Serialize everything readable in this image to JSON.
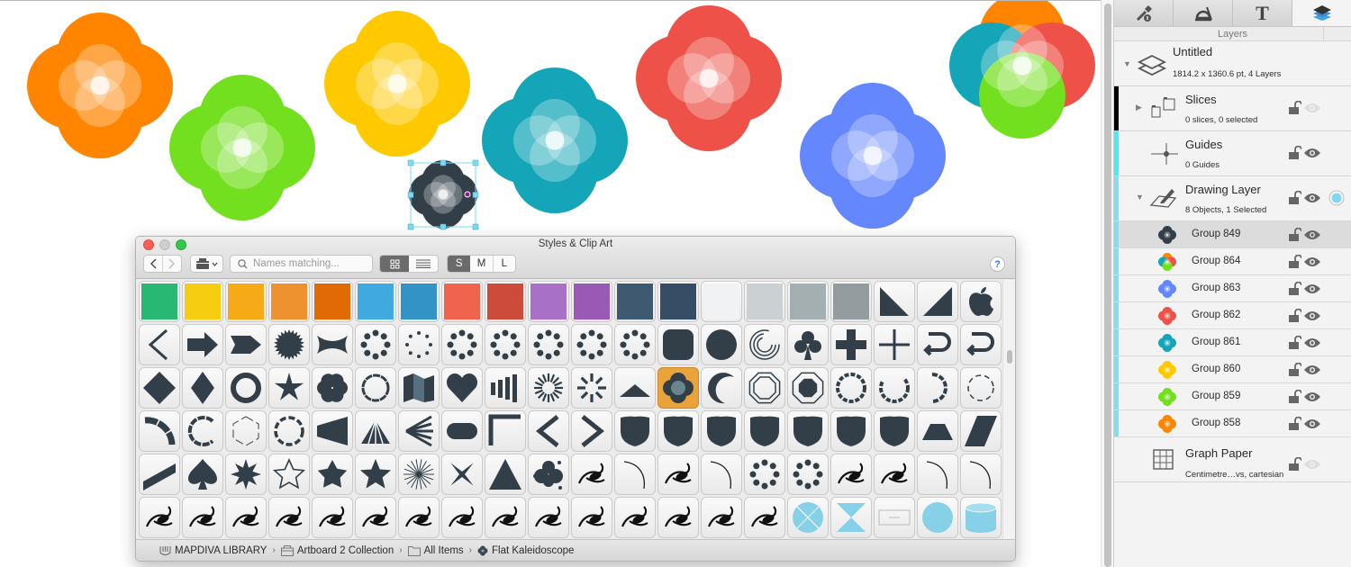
{
  "canvas": {
    "flowers": [
      {
        "name": "orange-flower",
        "color": "#ff8400"
      },
      {
        "name": "green-flower",
        "color": "#72e01e"
      },
      {
        "name": "yellow-flower",
        "color": "#ffc900"
      },
      {
        "name": "teal-flower",
        "color": "#14a6b8"
      },
      {
        "name": "red-flower",
        "color": "#ee5147"
      },
      {
        "name": "blue-flower",
        "color": "#6487fe"
      },
      {
        "name": "mixed-flower",
        "colors": [
          "#14a6b8",
          "#ee5147",
          "#ff8400",
          "#72e01e"
        ]
      },
      {
        "name": "dark-flower-selected",
        "color": "#333f48",
        "selected": true
      }
    ],
    "selection_color": "#7fd9f0"
  },
  "inspector": {
    "tabs": [
      {
        "name": "style-tab",
        "icon": "paint-dropper-icon"
      },
      {
        "name": "geometry-tab",
        "icon": "protractor-icon"
      },
      {
        "name": "text-tab",
        "icon": "text-T-icon",
        "label": "T"
      },
      {
        "name": "layers-tab",
        "icon": "layers-icon",
        "active": true
      }
    ],
    "section_label": "Layers",
    "document": {
      "title": "Untitled",
      "subtitle": "1814.2 x 1360.6 pt, 4 Layers"
    },
    "layers": [
      {
        "title": "Slices",
        "subtitle": "0 slices, 0 selected",
        "stripe": "#000000",
        "visible": false,
        "collapsed": true
      },
      {
        "title": "Guides",
        "subtitle": "0 Guides",
        "stripe": "#3ff0f5",
        "visible": true
      },
      {
        "title": "Drawing Layer",
        "subtitle": "8 Objects, 1 Selected",
        "stripe": "#7de0f3",
        "visible": true,
        "expanded": true,
        "active_color": "#7ed7f7"
      },
      {
        "title": "Graph Paper",
        "subtitle": "Centimetre…vs, cartesian",
        "visible": false
      }
    ],
    "objects": [
      {
        "label": "Group 849",
        "selected": true,
        "colors": [
          "#333f48"
        ]
      },
      {
        "label": "Group 864",
        "colors": [
          "#14a6b8",
          "#ee5147",
          "#ff8400",
          "#72e01e"
        ]
      },
      {
        "label": "Group 863",
        "colors": [
          "#6487fe"
        ]
      },
      {
        "label": "Group 862",
        "colors": [
          "#ee5147"
        ]
      },
      {
        "label": "Group 861",
        "colors": [
          "#14a6b8"
        ]
      },
      {
        "label": "Group 860",
        "colors": [
          "#ffc900"
        ]
      },
      {
        "label": "Group 859",
        "colors": [
          "#72e01e"
        ]
      },
      {
        "label": "Group 858",
        "colors": [
          "#ff8400"
        ]
      }
    ]
  },
  "styles_window": {
    "title": "Styles & Clip Art",
    "search_placeholder": "Names matching...",
    "view_modes": [
      "grid",
      "list"
    ],
    "active_view": "grid",
    "sizes": [
      "S",
      "M",
      "L"
    ],
    "active_size": "S",
    "help": "?",
    "swatches": [
      "#28b873",
      "#f6cd10",
      "#f7aa18",
      "#ee9230",
      "#e06a04",
      "#3fa9e0",
      "#3293c6",
      "#f0644e",
      "#cd4b3a",
      "#a970c7",
      "#9b59b6",
      "#3f5a70",
      "#354d65",
      "#f1f2f3",
      "#cbd1d3",
      "#a4afb1",
      "#939c9e"
    ],
    "items": [
      "swatch",
      "swatch",
      "swatch",
      "swatch",
      "swatch",
      "swatch",
      "swatch",
      "swatch",
      "swatch",
      "swatch",
      "swatch",
      "swatch",
      "swatch",
      "swatch",
      "swatch",
      "swatch",
      "swatch",
      "triangle-right-angle",
      "triangle-right-angle-mirrored",
      "apple-logo",
      "chevron-left",
      "arrow-right",
      "arrow-notched",
      "starburst",
      "bowtie",
      "droplet-ring",
      "dot-ring",
      "dot-circle",
      "droplets-3",
      "droplets-3b",
      "droplets-3c",
      "droplets-3d",
      "rounded-square",
      "circle",
      "spiral-rings",
      "club",
      "plus-thick",
      "plus-thin",
      "u-turn-arrow",
      "u-turn-arrow-right",
      "diamond",
      "diamond-narrow",
      "ring",
      "star-4-spiky",
      "flower-8",
      "scallop-ring",
      "folded-map",
      "heart",
      "bar-ramp",
      "sunburst-lines",
      "sunburst-dashes",
      "triangle-flat",
      "flat-kaleidoscope",
      "crescent",
      "octagon-outline",
      "octagon-filled",
      "dashed-ring",
      "dashed-arc",
      "dashed-half",
      "dashed-circle-thin",
      "arc-segment",
      "c-segmented",
      "hexagon-dashed",
      "circle-dashed",
      "trapezoid-wedge",
      "fan-up",
      "fan-left",
      "stadium",
      "corner",
      "chevron-left-wide",
      "chevron-right-wide",
      "shield-1",
      "shield-2",
      "shield-3",
      "shield-4",
      "shield-5",
      "shield-6",
      "shield-7",
      "trapezoid",
      "parallelogram",
      "slash-band",
      "spade",
      "star-8",
      "star-outline",
      "star-5-rounded",
      "star-5",
      "burst-lines",
      "star-4-thin",
      "triangle",
      "cloud-blob",
      "swirl-1",
      "curve-1",
      "swirl-2",
      "curve-2",
      "dot-arc-1",
      "dot-arc-2",
      "paisley",
      "lily-ornament",
      "hook-1",
      "hook-2",
      "flourish-leaf",
      "flourish-clover",
      "flourish-swirls",
      "leaf-curl",
      "flourish-ornate",
      "butterfly-ornament",
      "leaves",
      "ring-leaf",
      "vine-small",
      "flower-vine",
      "ornament-1",
      "ornament-2",
      "curl-swirl",
      "scroll-swirl",
      "blob",
      "circle-cross",
      "hourglass",
      "text-box",
      "circle-blue",
      "cylinder"
    ],
    "selected_item": "flat-kaleidoscope",
    "breadcrumb": [
      {
        "label": "MAPDIVA LIBRARY",
        "icon": "library-icon"
      },
      {
        "label": "Artboard 2 Collection",
        "icon": "collection-icon"
      },
      {
        "label": "All Items",
        "icon": "folder-icon"
      },
      {
        "label": "Flat Kaleidoscope",
        "icon": "kaleidoscope-icon"
      }
    ]
  }
}
